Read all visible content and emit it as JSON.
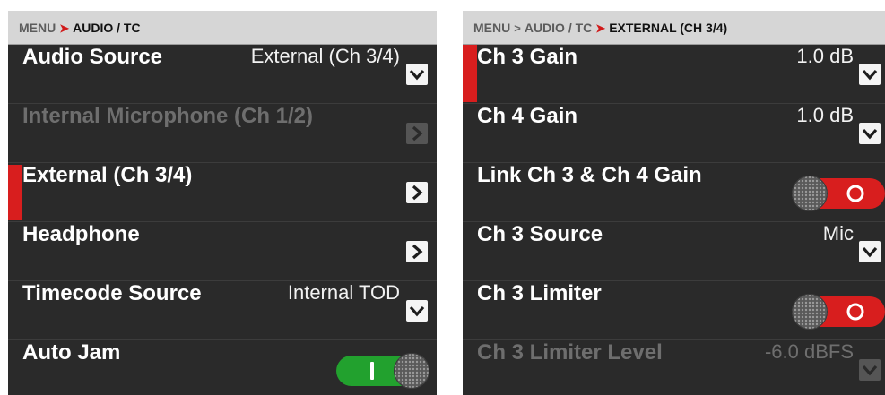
{
  "left_panel": {
    "breadcrumb": [
      "MENU",
      "AUDIO / TC"
    ],
    "rows": [
      {
        "label": "Audio Source",
        "value": "External (Ch 3/4)",
        "control": "dropdown",
        "enabled": true
      },
      {
        "label": "Internal Microphone (Ch 1/2)",
        "value": "",
        "control": "submenu",
        "enabled": false
      },
      {
        "label": "External (Ch 3/4)",
        "value": "",
        "control": "submenu",
        "enabled": true,
        "selected": true
      },
      {
        "label": "Headphone",
        "value": "",
        "control": "submenu",
        "enabled": true
      },
      {
        "label": "Timecode Source",
        "value": "Internal TOD",
        "control": "dropdown",
        "enabled": true
      },
      {
        "label": "Auto Jam",
        "value": "",
        "control": "toggle",
        "toggle_state": "on",
        "enabled": true
      }
    ]
  },
  "right_panel": {
    "breadcrumb": [
      "MENU",
      "AUDIO / TC",
      "EXTERNAL (CH 3/4)"
    ],
    "rows": [
      {
        "label": "Ch 3 Gain",
        "value": "1.0 dB",
        "control": "dropdown",
        "enabled": true,
        "selected": true
      },
      {
        "label": "Ch 4 Gain",
        "value": "1.0 dB",
        "control": "dropdown",
        "enabled": true
      },
      {
        "label": "Link Ch 3 & Ch 4 Gain",
        "value": "",
        "control": "toggle",
        "toggle_state": "off",
        "enabled": true
      },
      {
        "label": "Ch 3 Source",
        "value": "Mic",
        "control": "dropdown",
        "enabled": true
      },
      {
        "label": "Ch 3 Limiter",
        "value": "",
        "control": "toggle",
        "toggle_state": "off",
        "enabled": true
      },
      {
        "label": "Ch 3 Limiter Level",
        "value": "-6.0 dBFS",
        "control": "dropdown",
        "enabled": false
      }
    ]
  },
  "colors": {
    "accent_red": "#d81e1e",
    "toggle_on_green": "#22a12e",
    "toggle_off_red": "#d81e1e",
    "panel_bg": "#2a2a2a",
    "breadcrumb_bg": "#d6d6d6"
  },
  "icons": {
    "breadcrumb_separator": "chevron-right-icon",
    "dropdown": "chevron-down-icon",
    "submenu": "chevron-right-icon"
  }
}
